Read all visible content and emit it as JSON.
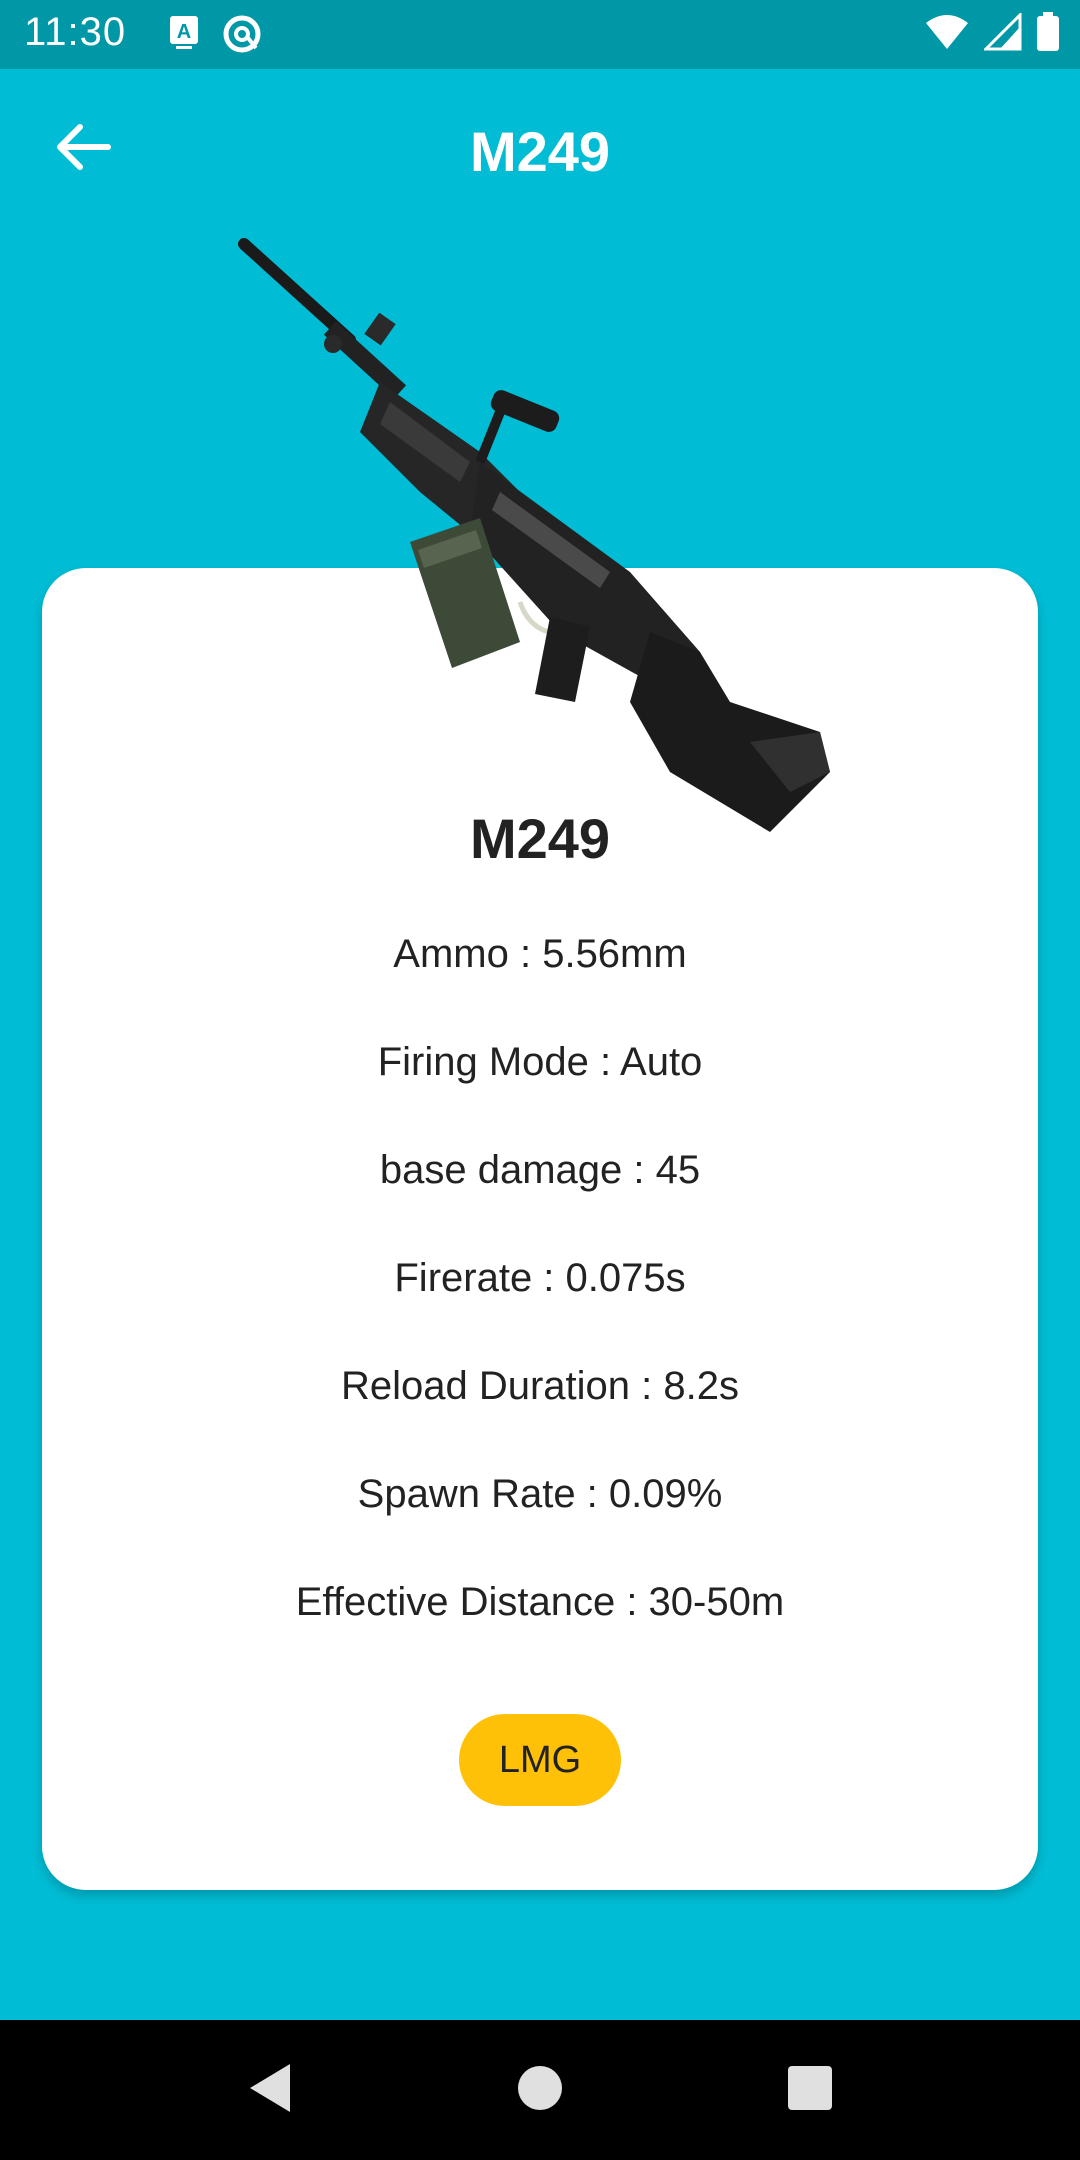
{
  "status": {
    "time": "11:30",
    "left_icons": [
      "keyboard-a-icon",
      "at-circle-icon"
    ],
    "right_icons": [
      "wifi-icon",
      "signal-icon",
      "battery-icon"
    ]
  },
  "appbar": {
    "back_icon": "arrow-left-icon",
    "title": "M249"
  },
  "weapon": {
    "image": "m249-lmg-image",
    "name": "M249",
    "stats": [
      "Ammo : 5.56mm",
      "Firing Mode : Auto",
      "base damage : 45",
      "Firerate : 0.075s",
      "Reload Duration : 8.2s",
      "Spawn Rate : 0.09%",
      "Effective Distance : 30-50m"
    ],
    "category": "LMG"
  },
  "navigation": {
    "buttons": [
      "back-triangle-icon",
      "home-circle-icon",
      "recents-square-icon"
    ]
  },
  "colors": {
    "background": "#00BCD4",
    "status_bar": "#0097A7",
    "chip": "#FFC107",
    "card": "#FFFFFF"
  }
}
